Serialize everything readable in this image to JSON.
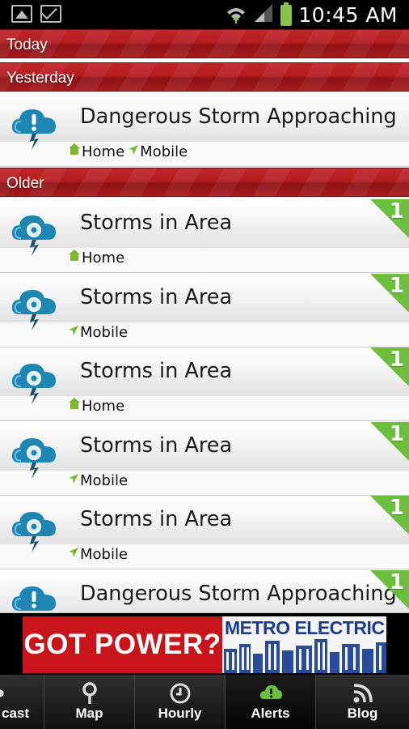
{
  "status_bar": {
    "time": "10:45 AM",
    "icons": [
      "gallery-icon",
      "email-icon",
      "wifi-icon",
      "signal-icon",
      "battery-icon"
    ]
  },
  "sections": {
    "today": "Today",
    "yesterday": "Yesterday",
    "older": "Older"
  },
  "yesterday_alerts": [
    {
      "title": "Dangerous Storm Approaching",
      "icon": "storm-warning-icon",
      "tags": [
        "Home",
        "Mobile"
      ]
    }
  ],
  "older_alerts": [
    {
      "title": "Storms in Area",
      "icon": "storm-icon",
      "tags": [
        "Home"
      ],
      "badge": "1"
    },
    {
      "title": "Storms in Area",
      "icon": "storm-icon",
      "tags": [
        "Mobile"
      ],
      "badge": "1"
    },
    {
      "title": "Storms in Area",
      "icon": "storm-icon",
      "tags": [
        "Home"
      ],
      "badge": "1"
    },
    {
      "title": "Storms in Area",
      "icon": "storm-icon",
      "tags": [
        "Mobile"
      ],
      "badge": "1"
    },
    {
      "title": "Storms in Area",
      "icon": "storm-icon",
      "tags": [
        "Mobile"
      ],
      "badge": "1"
    },
    {
      "title": "Dangerous Storm Approaching",
      "icon": "storm-warning-icon",
      "tags": [],
      "badge": "1"
    }
  ],
  "ad": {
    "headline": "GOT POWER?",
    "brand": "METRO ELECTRIC"
  },
  "nav": {
    "forecast": "cast",
    "map": "Map",
    "hourly": "Hourly",
    "alerts": "Alerts",
    "blog": "Blog",
    "active": "alerts"
  },
  "colors": {
    "header_red": "#b51d20",
    "badge_green": "#6cbf3c",
    "storm_blue": "#1d86b3",
    "ad_red": "#c8141a",
    "ad_blue": "#1d3c8a"
  }
}
